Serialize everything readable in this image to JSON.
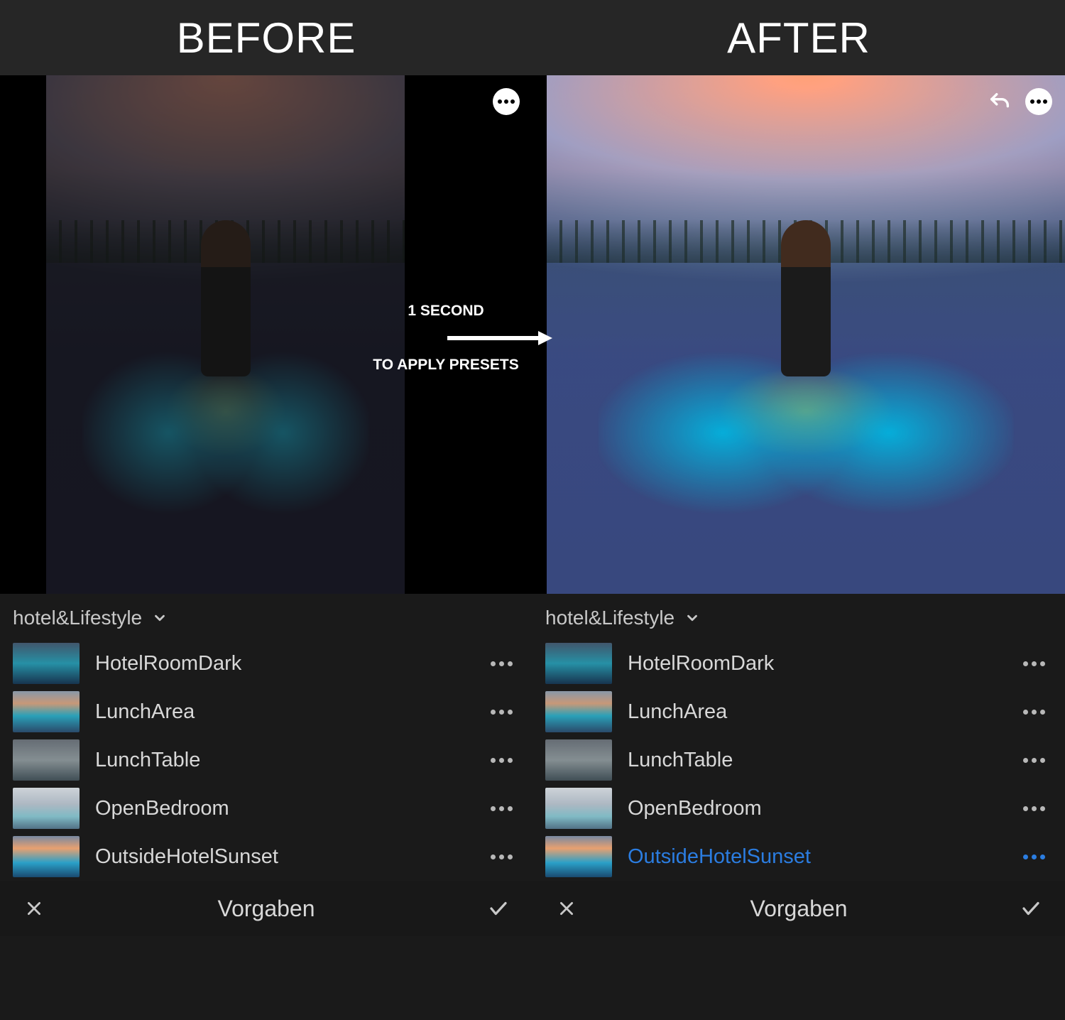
{
  "header": {
    "before_label": "BEFORE",
    "after_label": "AFTER"
  },
  "overlay": {
    "line1": "1 SECOND",
    "line2": "TO APPLY PRESETS"
  },
  "group": {
    "name": "hotel&Lifestyle"
  },
  "presets": [
    {
      "name": "HotelRoomDark"
    },
    {
      "name": "LunchArea"
    },
    {
      "name": "LunchTable"
    },
    {
      "name": "OpenBedroom"
    },
    {
      "name": "OutsideHotelSunset"
    }
  ],
  "after_selected_index": 4,
  "bottom": {
    "title": "Vorgaben"
  }
}
